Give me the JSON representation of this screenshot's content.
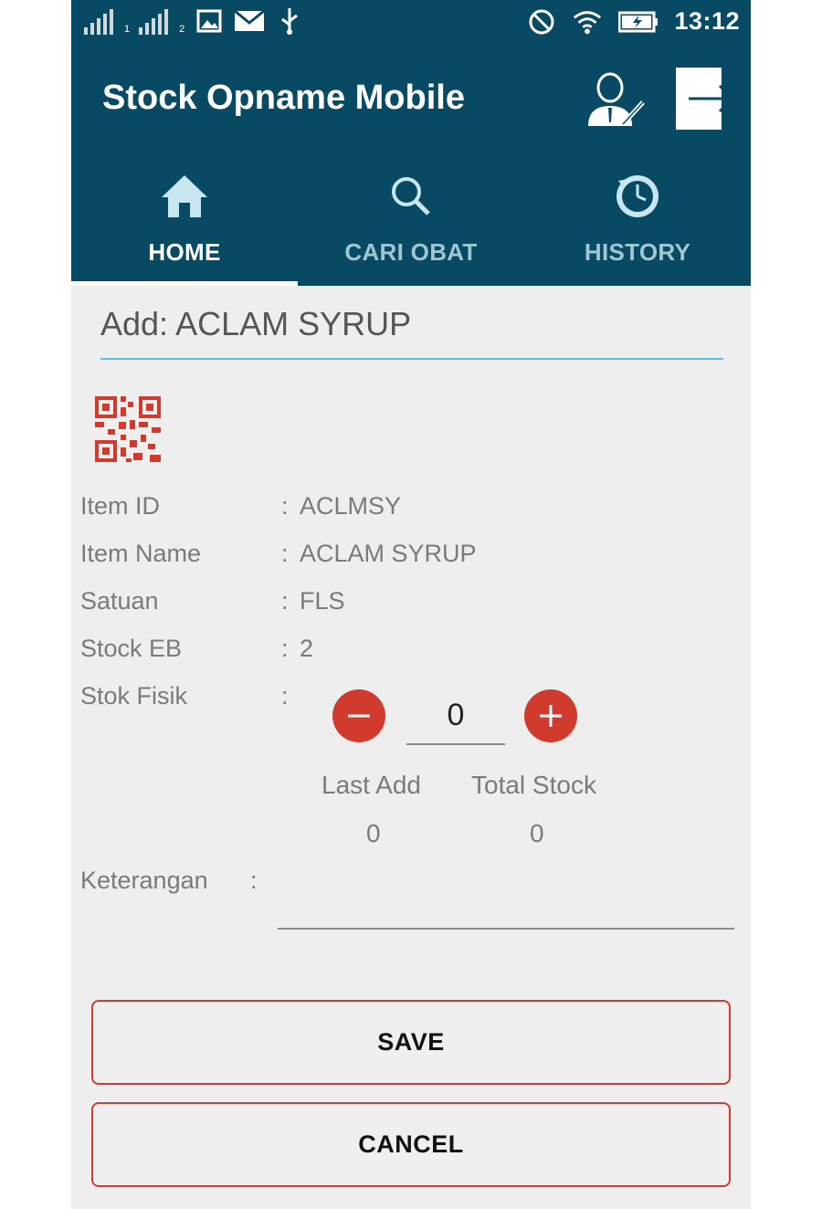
{
  "status_bar": {
    "sim1_label": "1",
    "sim2_label": "2",
    "time": "13:12",
    "icons": [
      "signal-icon",
      "signal-icon",
      "image-icon",
      "mail-icon",
      "usb-icon",
      "do-not-disturb-icon",
      "wifi-icon",
      "battery-icon"
    ]
  },
  "app": {
    "title": "Stock Opname Mobile",
    "colors": {
      "primary": "#084a63",
      "accent": "#d13b2d",
      "underline": "#5ec0e0"
    }
  },
  "tabs": [
    {
      "label": "HOME",
      "icon": "home-icon",
      "active": true
    },
    {
      "label": "CARI OBAT",
      "icon": "search-icon",
      "active": false
    },
    {
      "label": "HISTORY",
      "icon": "history-icon",
      "active": false
    }
  ],
  "form": {
    "title": "Add: ACLAM SYRUP",
    "fields": [
      {
        "label": "Item ID",
        "colon": ":",
        "value": "ACLMSY"
      },
      {
        "label": "Item Name",
        "colon": ":",
        "value": "ACLAM SYRUP"
      },
      {
        "label": "Satuan",
        "colon": ":",
        "value": "FLS"
      },
      {
        "label": "Stock EB",
        "colon": ":",
        "value": "2"
      }
    ],
    "stok_fisik": {
      "label": "Stok Fisik",
      "colon": ":",
      "value": "0"
    },
    "last_add": {
      "label": "Last Add",
      "value": "0"
    },
    "total_stock": {
      "label": "Total Stock",
      "value": "0"
    },
    "keterangan": {
      "label": "Keterangan",
      "colon": ":",
      "value": ""
    }
  },
  "buttons": {
    "save": "SAVE",
    "cancel": "CANCEL"
  }
}
